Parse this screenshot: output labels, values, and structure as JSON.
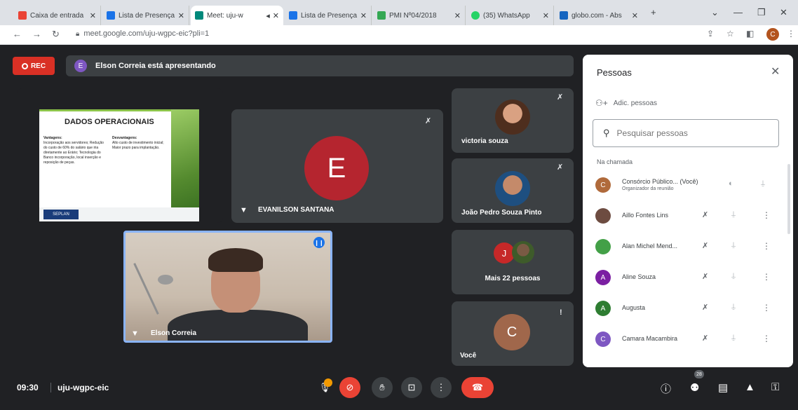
{
  "browser": {
    "tabs": [
      {
        "title": "Caixa de entrada",
        "color": "#ea4335"
      },
      {
        "title": "Lista de Presença",
        "color": "#1a73e8"
      },
      {
        "title": "Meet: uju-w",
        "color": "#00897b"
      },
      {
        "title": "Lista de Presença",
        "color": "#1a73e8"
      },
      {
        "title": "PMI Nº04/2018",
        "color": "#34a853"
      },
      {
        "title": "(35) WhatsApp",
        "color": "#25d366"
      },
      {
        "title": "globo.com - Abs",
        "color": "#1565c0"
      }
    ],
    "new_tab": "+",
    "url": "meet.google.com/uju-wgpc-eic?pli=1"
  },
  "meet": {
    "rec_label": "REC",
    "presenter_initial": "E",
    "presenting_text": "Elson Correia está apresentando",
    "slide": {
      "title": "DADOS OPERACIONAIS",
      "left_heading": "Vantagens:",
      "left_text": "Incorporação aos servidores; Redução do custo de 60% do salário que iria diretamente ao Erário; Tecnologia do Banco incorporação, local inserção e reposição de peças.",
      "right_heading": "Desvantagens:",
      "right_text": "Alto custo de investimento inicial; Maior prazo para implantação.",
      "logo": "SEPLAN"
    },
    "tiles": {
      "evanilson": {
        "name": "EVANILSON SANTANA",
        "initial": "E"
      },
      "elson": {
        "name": "Elson Correia"
      },
      "victoria": {
        "name": "victoria souza"
      },
      "joao": {
        "name": "João Pedro Souza Pinto"
      },
      "more": {
        "name": "Mais 22 pessoas",
        "initial": "J"
      },
      "you": {
        "name": "Você",
        "initial": "C"
      }
    },
    "bottom": {
      "time": "09:30",
      "code": "uju-wgpc-eic",
      "people_count": "28"
    }
  },
  "panel": {
    "title": "Pessoas",
    "add_label": "Adic. pessoas",
    "search_placeholder": "Pesquisar pessoas",
    "section": "Na chamada",
    "people": [
      {
        "initial": "C",
        "name": "Consórcio Público... (Você)",
        "sub": "Organizador da reunião",
        "color": "#b06a3b"
      },
      {
        "initial": "",
        "name": "Aillo Fontes Lins",
        "sub": "",
        "color": "#6d4c41"
      },
      {
        "initial": "",
        "name": "Alan Michel Mend...",
        "sub": "",
        "color": "#43a047"
      },
      {
        "initial": "A",
        "name": "Aline Souza",
        "sub": "",
        "color": "#7b1fa2"
      },
      {
        "initial": "A",
        "name": "Augusta",
        "sub": "",
        "color": "#2e7d32"
      },
      {
        "initial": "C",
        "name": "Camara Macambira",
        "sub": "",
        "color": "#7e57c2"
      }
    ]
  }
}
